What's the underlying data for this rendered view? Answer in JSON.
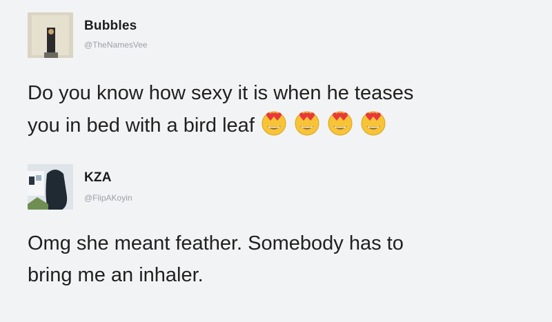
{
  "tweets": [
    {
      "name": "Bubbles",
      "handle": "@TheNamesVee",
      "line1": "Do you know how sexy it is when he teases",
      "line2": "you in bed with a bird leaf",
      "emojis": [
        "heart-eyes-emoji",
        "heart-eyes-emoji",
        "heart-eyes-emoji",
        "heart-eyes-emoji"
      ]
    },
    {
      "name": "KZA",
      "handle": "@FlipAKoyin",
      "line1": "Omg she meant feather. Somebody has to",
      "line2": "bring me an inhaler."
    }
  ],
  "colors": {
    "background": "#f2f3f5",
    "text": "#202020",
    "handle": "#9aa0a6",
    "emoji_face": "#f7c437",
    "emoji_heart": "#e8383d"
  }
}
